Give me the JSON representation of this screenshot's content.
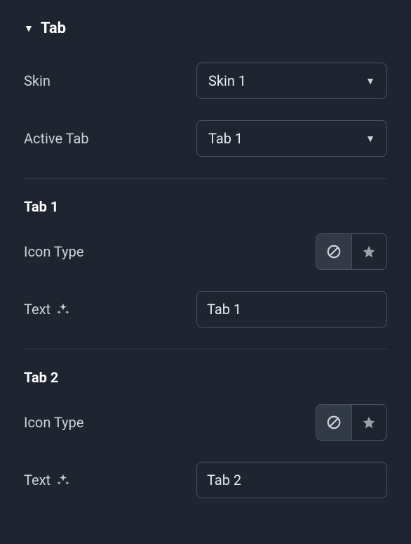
{
  "header": {
    "title": "Tab"
  },
  "fields": {
    "skin": {
      "label": "Skin",
      "value": "Skin 1"
    },
    "activeTab": {
      "label": "Active Tab",
      "value": "Tab 1"
    }
  },
  "tab1": {
    "header": "Tab 1",
    "iconType": {
      "label": "Icon Type",
      "selected": "none"
    },
    "text": {
      "label": "Text",
      "value": "Tab 1"
    }
  },
  "tab2": {
    "header": "Tab 2",
    "iconType": {
      "label": "Icon Type",
      "selected": "none"
    },
    "text": {
      "label": "Text",
      "value": "Tab 2"
    }
  }
}
